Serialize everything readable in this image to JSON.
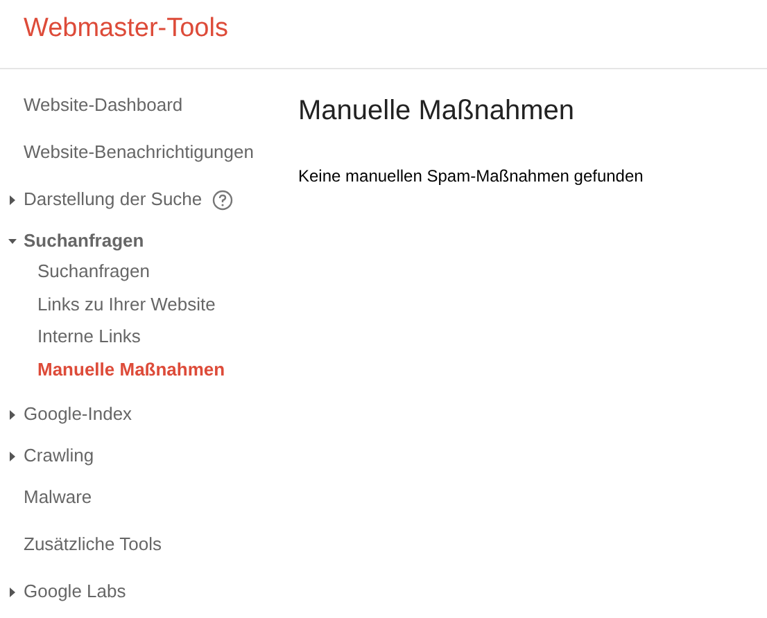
{
  "header": {
    "title": "Webmaster-Tools"
  },
  "nav": [
    {
      "kind": "link",
      "label": "Website-Dashboard",
      "selected": false
    },
    {
      "kind": "link",
      "label": "Website-Benachrichtigungen",
      "selected": false
    },
    {
      "kind": "section",
      "label": "Darstellung der Suche",
      "expanded": false,
      "help": true
    },
    {
      "kind": "section",
      "label": "Suchanfragen",
      "expanded": true,
      "children": [
        {
          "label": "Suchanfragen",
          "selected": false
        },
        {
          "label": "Links zu Ihrer Website",
          "selected": false
        },
        {
          "label": "Interne Links",
          "selected": false
        },
        {
          "label": "Manuelle Maßnahmen",
          "selected": true
        }
      ]
    },
    {
      "kind": "section",
      "label": "Google-Index",
      "expanded": false
    },
    {
      "kind": "section",
      "label": "Crawling",
      "expanded": false
    },
    {
      "kind": "link",
      "label": "Malware",
      "selected": false
    },
    {
      "kind": "link",
      "label": "Zusätzliche Tools",
      "selected": false
    },
    {
      "kind": "section",
      "label": "Google Labs",
      "expanded": false
    }
  ],
  "content": {
    "heading": "Manuelle Maßnahmen",
    "message": "Keine manuellen Spam-Maßnahmen gefunden"
  }
}
